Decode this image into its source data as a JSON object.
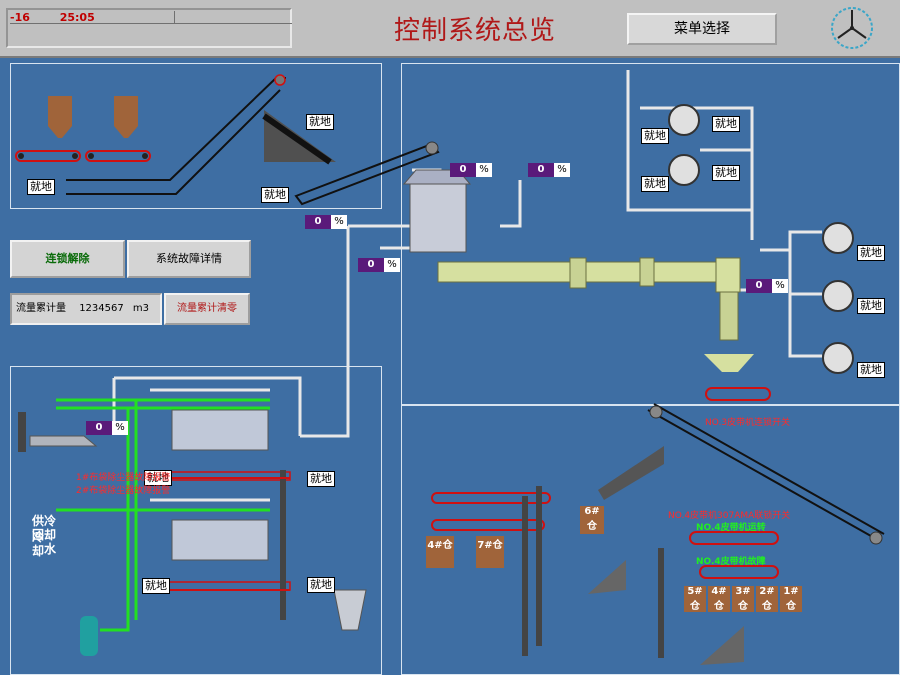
{
  "header": {
    "clock_prefix": "-16",
    "clock_time": "25:05",
    "title": "控制系统总览",
    "menu_button": "菜单选择"
  },
  "controls": {
    "interlock_release": "连锁解除",
    "system_fault_detail": "系统故障详情",
    "flow_total_label": "流量累计量",
    "flow_total_value": "1234567",
    "flow_total_unit": "m3",
    "flow_reset": "流量累计清零"
  },
  "flow_percent": {
    "value": "0",
    "unit": "%"
  },
  "labels": {
    "local": "就地",
    "bin_4": "4#仓",
    "bin_5": "5#仓",
    "bin_6": "6#仓",
    "bin_7": "7#仓",
    "bin_1": "1#仓",
    "bin_2": "2#仓",
    "bin_3": "3#仓",
    "cooling_return": "供回冷却水",
    "cooling_left": "供回",
    "cooling_mid": "冷却",
    "cooling_right": "冷却水"
  },
  "alarms": {
    "conveyor_no3": "NO.3皮带机连锁开关",
    "conveyor_no4_chain": "NO.4皮带机307AMA联锁开关",
    "conveyor_no4_run": "NO.4皮带机运转",
    "conveyor_no4_fault": "NO.4皮带机故障",
    "dust_fault_1": "1#布袋除尘器故障报警",
    "dust_fault_2": "2#布袋除尘器故障报警"
  },
  "status": {
    "bag_a": "除尘器",
    "bag_b": "除尘器"
  },
  "colors": {
    "background": "#3e6ea3",
    "title": "#b01818",
    "pipe_green": "#22e022",
    "silo": "#a0643a",
    "percent_box": "#5a1a7a"
  }
}
